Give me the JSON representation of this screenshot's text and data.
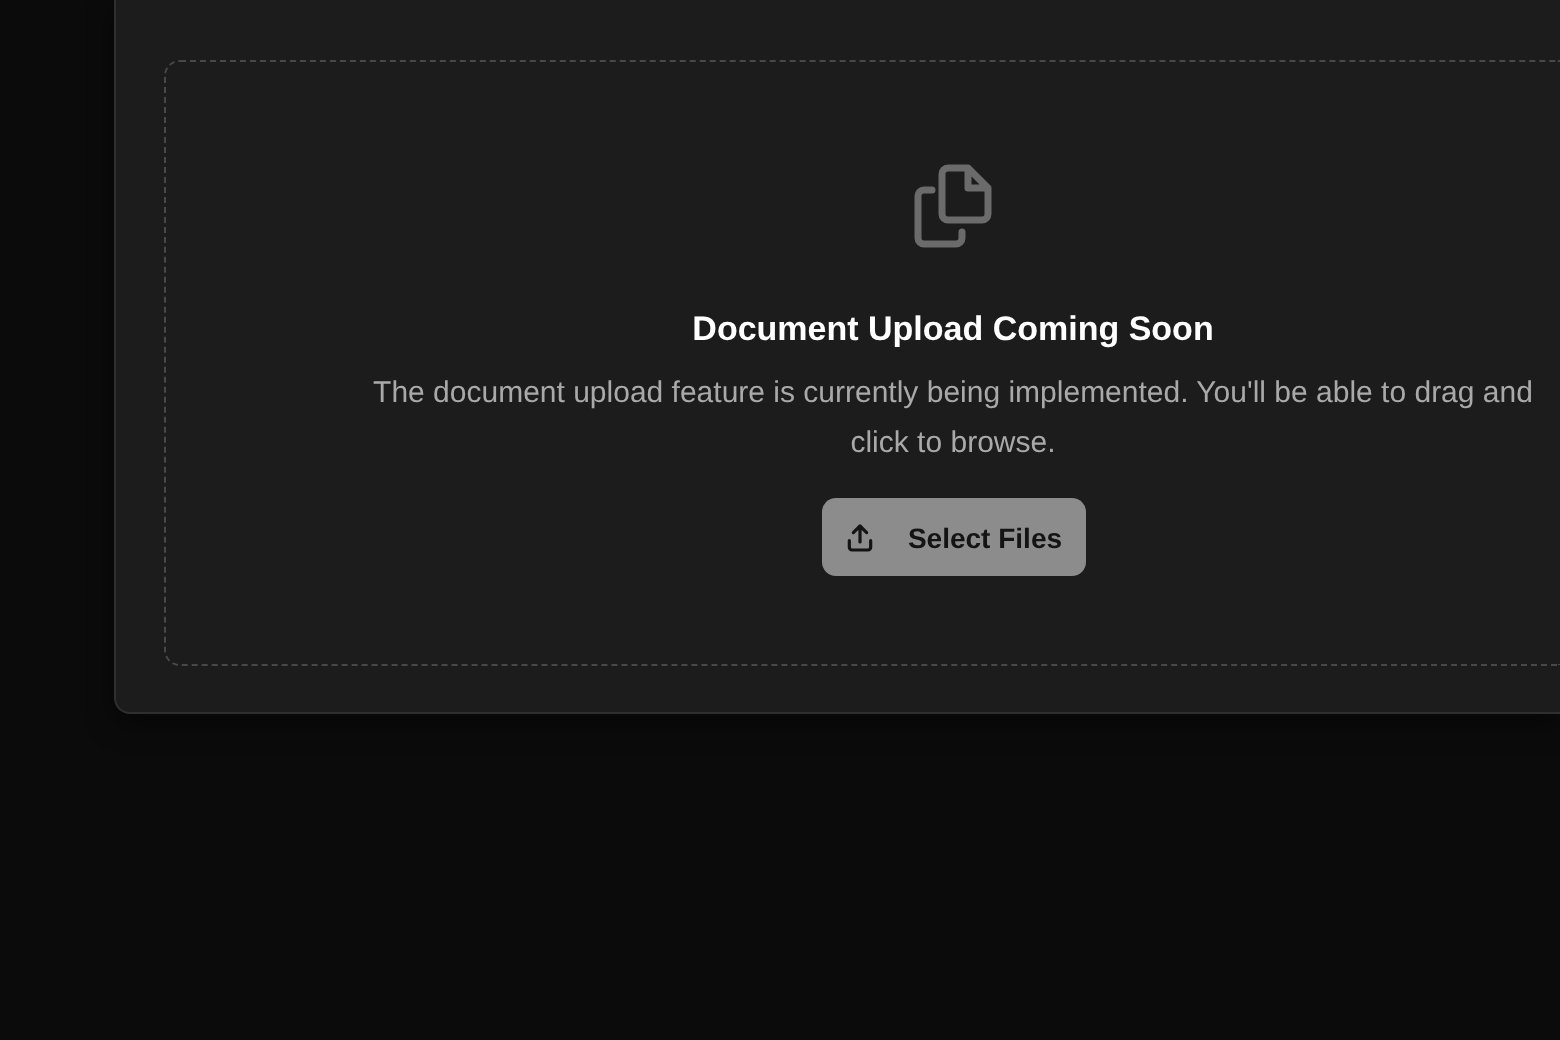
{
  "upload_panel": {
    "title": "Document Upload Coming Soon",
    "description_lines": [
      "The document upload feature is currently being implemented. You'll be able to drag and",
      "click to browse."
    ],
    "button": {
      "label": "Select Files"
    }
  }
}
